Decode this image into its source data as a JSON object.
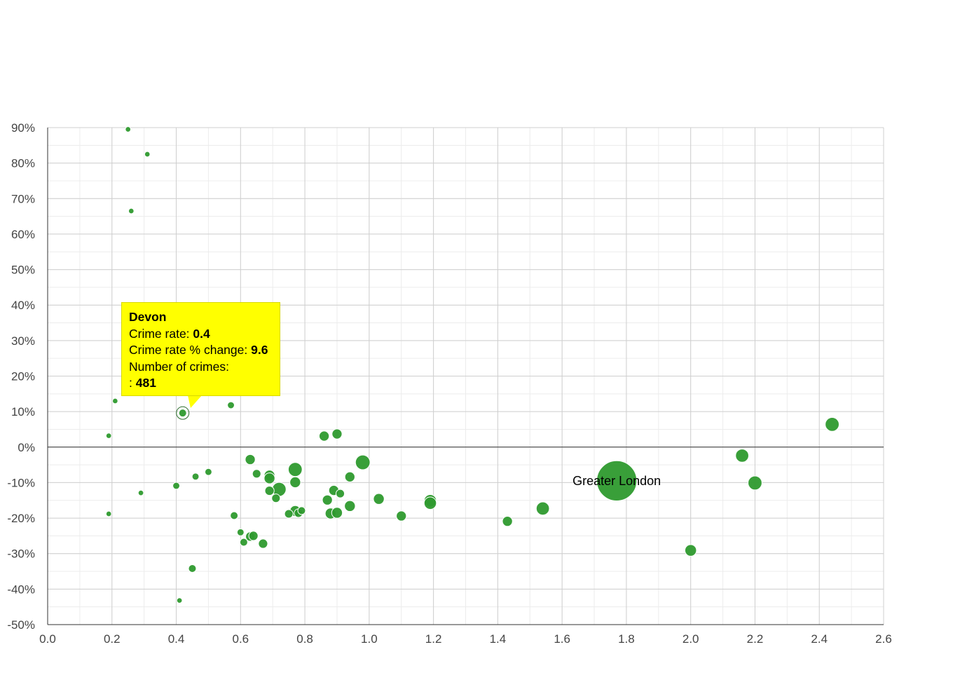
{
  "chart_data": {
    "type": "scatter",
    "title": "",
    "xlabel": "",
    "ylabel": "",
    "xlim": [
      0,
      2.6
    ],
    "ylim": [
      -50,
      90
    ],
    "x_ticks": [
      "0.0",
      "0.2",
      "0.4",
      "0.6",
      "0.8",
      "1.0",
      "1.2",
      "1.4",
      "1.6",
      "1.8",
      "2.0",
      "2.2",
      "2.4",
      "2.6"
    ],
    "y_ticks": [
      "90%",
      "80%",
      "70%",
      "60%",
      "50%",
      "40%",
      "30%",
      "20%",
      "10%",
      "0%",
      "-10%",
      "-20%",
      "-30%",
      "-40%",
      "-50%"
    ],
    "grid": true,
    "legend": "none",
    "colors": {
      "point": "#2e9a2e",
      "point_stroke": "#ffffff",
      "tooltip_bg": "#ffff00"
    },
    "series": [
      {
        "points": [
          {
            "x": 0.25,
            "y": 89.5,
            "size": 0.7
          },
          {
            "x": 0.31,
            "y": 82.5,
            "size": 0.7
          },
          {
            "x": 0.26,
            "y": 66.5,
            "size": 0.7
          },
          {
            "x": 0.21,
            "y": 13.0,
            "size": 0.7
          },
          {
            "x": 0.19,
            "y": 3.2,
            "size": 0.7
          },
          {
            "x": 0.19,
            "y": -18.8,
            "size": 0.7
          },
          {
            "x": 0.29,
            "y": -12.9,
            "size": 0.7
          },
          {
            "x": 0.4,
            "y": -10.9,
            "size": 0.9
          },
          {
            "x": 0.41,
            "y": -43.2,
            "size": 0.7
          },
          {
            "x": 0.42,
            "y": 9.6,
            "size": 1.0,
            "label": "Devon"
          },
          {
            "x": 0.45,
            "y": -34.2,
            "size": 1.0
          },
          {
            "x": 0.46,
            "y": -8.3,
            "size": 0.9
          },
          {
            "x": 0.5,
            "y": -7.0,
            "size": 0.9
          },
          {
            "x": 0.57,
            "y": 11.8,
            "size": 0.9
          },
          {
            "x": 0.58,
            "y": -19.3,
            "size": 1.0
          },
          {
            "x": 0.6,
            "y": -24.0,
            "size": 0.9
          },
          {
            "x": 0.61,
            "y": -26.8,
            "size": 1.0
          },
          {
            "x": 0.63,
            "y": -3.5,
            "size": 1.3
          },
          {
            "x": 0.63,
            "y": -25.2,
            "size": 1.2
          },
          {
            "x": 0.64,
            "y": -25.0,
            "size": 1.2
          },
          {
            "x": 0.65,
            "y": -7.5,
            "size": 1.1
          },
          {
            "x": 0.67,
            "y": -27.2,
            "size": 1.2
          },
          {
            "x": 0.69,
            "y": -8.0,
            "size": 1.4
          },
          {
            "x": 0.69,
            "y": -8.8,
            "size": 1.4
          },
          {
            "x": 0.69,
            "y": -12.3,
            "size": 1.2
          },
          {
            "x": 0.71,
            "y": -14.4,
            "size": 1.1
          },
          {
            "x": 0.72,
            "y": -11.9,
            "size": 1.8
          },
          {
            "x": 0.75,
            "y": -18.8,
            "size": 1.1
          },
          {
            "x": 0.77,
            "y": -6.3,
            "size": 1.8
          },
          {
            "x": 0.77,
            "y": -9.9,
            "size": 1.4
          },
          {
            "x": 0.77,
            "y": -18.0,
            "size": 1.4
          },
          {
            "x": 0.78,
            "y": -18.6,
            "size": 1.1
          },
          {
            "x": 0.79,
            "y": -17.9,
            "size": 1.0
          },
          {
            "x": 0.86,
            "y": 3.1,
            "size": 1.3
          },
          {
            "x": 0.87,
            "y": -14.9,
            "size": 1.3
          },
          {
            "x": 0.88,
            "y": -18.7,
            "size": 1.4
          },
          {
            "x": 0.89,
            "y": -12.2,
            "size": 1.3
          },
          {
            "x": 0.9,
            "y": 3.7,
            "size": 1.3
          },
          {
            "x": 0.9,
            "y": -18.5,
            "size": 1.4
          },
          {
            "x": 0.91,
            "y": -13.1,
            "size": 1.1
          },
          {
            "x": 0.94,
            "y": -8.4,
            "size": 1.3
          },
          {
            "x": 0.94,
            "y": -16.6,
            "size": 1.4
          },
          {
            "x": 0.98,
            "y": -4.3,
            "size": 1.9
          },
          {
            "x": 1.03,
            "y": -14.6,
            "size": 1.4
          },
          {
            "x": 1.1,
            "y": -19.4,
            "size": 1.3
          },
          {
            "x": 1.19,
            "y": -15.1,
            "size": 1.6
          },
          {
            "x": 1.19,
            "y": -15.8,
            "size": 1.6
          },
          {
            "x": 1.43,
            "y": -20.9,
            "size": 1.3
          },
          {
            "x": 1.54,
            "y": -17.3,
            "size": 1.7
          },
          {
            "x": 1.77,
            "y": -9.5,
            "size": 5.2,
            "label": "Greater London"
          },
          {
            "x": 2.0,
            "y": -29.1,
            "size": 1.5
          },
          {
            "x": 2.16,
            "y": -2.4,
            "size": 1.7
          },
          {
            "x": 2.2,
            "y": -10.1,
            "size": 1.8
          },
          {
            "x": 2.44,
            "y": 6.4,
            "size": 1.8
          }
        ]
      }
    ],
    "point_labels": [
      {
        "text": "Greater London",
        "x": 1.77,
        "y": -9.5
      }
    ],
    "tooltip": {
      "title": "Devon",
      "crime_rate_label": "Crime rate: ",
      "crime_rate_value": "0.4",
      "change_label": "Crime rate % change: ",
      "change_value": "9.6",
      "count_label": "Number of crimes:",
      "count_prefix": ": ",
      "count_value": "481"
    }
  }
}
